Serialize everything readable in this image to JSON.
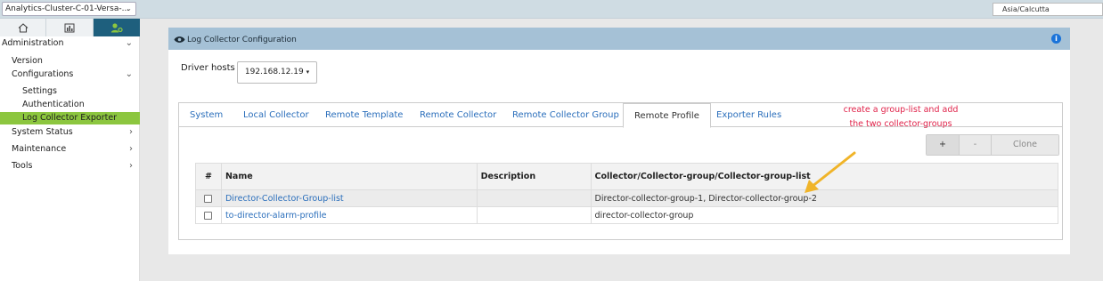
{
  "topbar": {
    "cluster": "Analytics-Cluster-C-01-Versa-...",
    "timezone": "Asia/Calcutta"
  },
  "sidebar": {
    "icons": [
      "home-icon",
      "chart-icon",
      "admin-icon"
    ],
    "items": [
      {
        "label": "Administration"
      },
      {
        "label": "Version"
      },
      {
        "label": "Configurations"
      },
      {
        "label": "Settings"
      },
      {
        "label": "Authentication"
      },
      {
        "label": "Log Collector Exporter"
      },
      {
        "label": "System Status"
      },
      {
        "label": "Maintenance"
      },
      {
        "label": "Tools"
      }
    ]
  },
  "panel": {
    "title": "Log Collector Configuration",
    "driver_label": "Driver hosts",
    "driver_value": "192.168.12.19",
    "tabs": [
      {
        "label": "System"
      },
      {
        "label": "Local Collector"
      },
      {
        "label": "Remote Template"
      },
      {
        "label": "Remote Collector"
      },
      {
        "label": "Remote Collector Group"
      },
      {
        "label": "Remote Profile"
      },
      {
        "label": "Exporter Rules"
      }
    ],
    "active_tab": "Remote Profile",
    "annotation": {
      "line1": "create a group-list and add",
      "line2": "the two collector-groups"
    },
    "buttons": {
      "add": "+",
      "remove": "-",
      "clone": "Clone"
    },
    "table": {
      "headers": [
        "#",
        "Name",
        "Description",
        "Collector/Collector-group/Collector-group-list"
      ],
      "rows": [
        {
          "name": "Director-Collector-Group-list",
          "description": "",
          "collector": "Director-collector-group-1, Director-collector-group-2"
        },
        {
          "name": "to-director-alarm-profile",
          "description": "",
          "collector": "director-collector-group"
        }
      ]
    }
  },
  "colors": {
    "accent_green": "#8cc63f",
    "header_blue": "#a5c1d6",
    "link_blue": "#2a6ebb",
    "annotation_red": "#e0234a",
    "arrow_yellow": "#f0b429"
  }
}
